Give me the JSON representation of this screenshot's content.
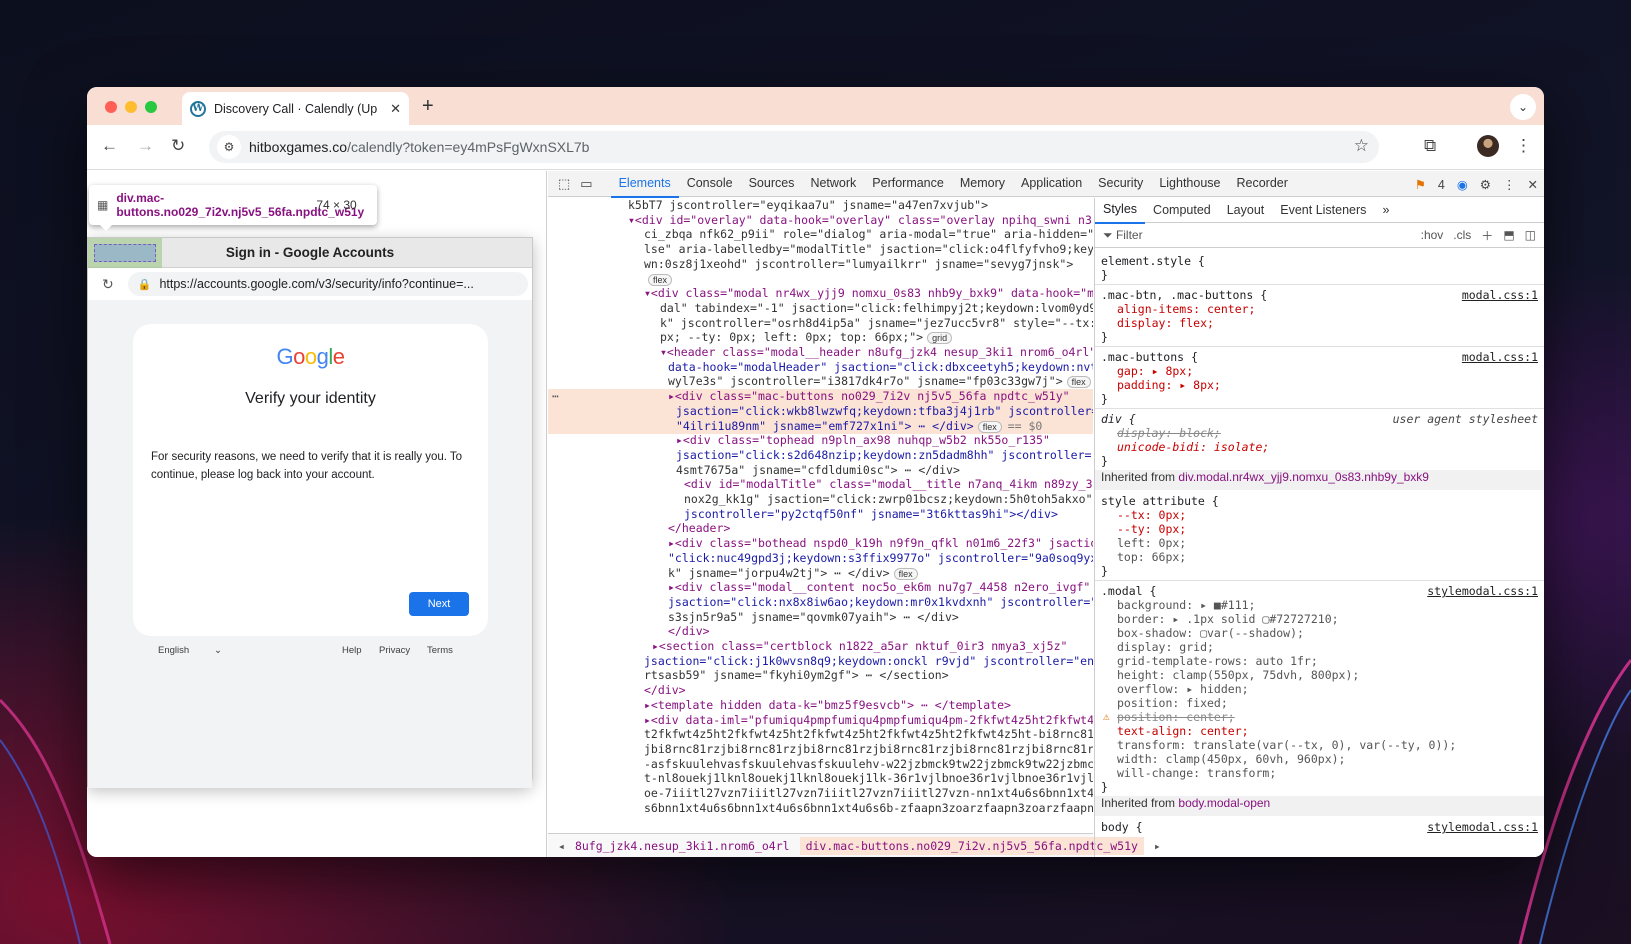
{
  "window": {
    "tab_title": "Discovery Call · Calendly (Up",
    "new_tab": "+"
  },
  "address": {
    "domain": "hitboxgames.co",
    "path": "/calendly?token=ey4mPsFgWxnSXL7b"
  },
  "inspect_tooltip": {
    "selector": "div.mac-buttons.no029_7i2v.nj5v5_56fa.npdtc_w51y",
    "size": "74 × 30"
  },
  "popup": {
    "title": "Sign in - Google Accounts",
    "url": "https://accounts.google.com/v3/security/info?continue=...",
    "logo": "Google",
    "heading": "Verify your identity",
    "message": "For security reasons, we need to verify that it is really you. To continue, please log back into your account.",
    "next": "Next",
    "language": "English",
    "help": "Help",
    "privacy": "Privacy",
    "terms": "Terms"
  },
  "devtools": {
    "tabs": [
      "Elements",
      "Console",
      "Sources",
      "Network",
      "Performance",
      "Memory",
      "Application",
      "Security",
      "Lighthouse",
      "Recorder"
    ],
    "issues_count": "4",
    "dom_lines": [
      "k5bT7  jscontroller=\"eyqikaa7u\"  jsname=\"a47en7xvjub\">",
      "▾<div id=\"overlay\" data-hook=\"overlay\" class=\"overlay npihq_swni n3j",
      "ci_zbqa nfk62_p9ii\" role=\"dialog\" aria-modal=\"true\" aria-hidden=\"fa",
      "lse\" aria-labelledby=\"modalTitle\" jsaction=\"click:o4flfyfvho9;keydo",
      "wn:0sz8j1xeohd\" jscontroller=\"lumyailkrr\" jsname=\"sevyg7jnsk\">",
      "flex",
      "▾<div class=\"modal nr4wx_yjj9 nomxu_0s83 nhb9y_bxk9\" data-hook=\"mo",
      "dal\" tabindex=\"-1\" jsaction=\"click:felhimpyj2t;keydown:lvom0yd9i",
      "k\" jscontroller=\"osrh8d4ip5a\" jsname=\"jez7ucc5vr8\" style=\"--tx: 0",
      "px; --ty: 0px; left: 0px; top: 66px;\">  grid",
      "▾<header class=\"modal__header n8ufg_jzk4 nesup_3ki1 nrom6_o4rl\"",
      "data-hook=\"modalHeader\" jsaction=\"click:dbxceetyh5;keydown:nvtd",
      "wyl7e3s\" jscontroller=\"i3817dk4r7o\" jsname=\"fp03c33gw7j\">  flex",
      "▸<div class=\"mac-buttons no029_7i2v nj5v5_56fa npdtc_w51y\"",
      "jsaction=\"click:wkb8lwzwfq;keydown:tfba3j4j1rb\" jscontroller=",
      "\"4ilri1u89nm\" jsname=\"emf727x1ni\"> ⋯ </div>  flex  == $0",
      "▸<div class=\"tophead n9pln_ax98 nuhqp_w5b2 nk55o_r135\"",
      "jsaction=\"click:s2d648nzip;keydown:zn5dadm8hh\" jscontroller=\"l",
      "4smt7675a\" jsname=\"cfdldumi0sc\"> ⋯ </div>",
      "<div id=\"modalTitle\" class=\"modal__title n7anq_4ikm n89zy_36zs",
      "nox2g_kk1g\" jsaction=\"click:zwrp01bcsz;keydown:5h0toh5akxo\"",
      "jscontroller=\"py2ctqf50nf\" jsname=\"3t6kttas9hi\"></div>",
      "</header>",
      "▸<div class=\"bothead nspd0_k19h n9f9n_qfkl n01m6_22f3\" jsaction=",
      "\"click:nuc49gpd3j;keydown:s3ffix9977o\" jscontroller=\"9a0soq9yx8",
      "k\" jsname=\"jorpu4w2tj\"> ⋯ </div>  flex",
      "▸<div class=\"modal__content noc5o_ek6m nu7g7_4458 n2ero_ivgf\"",
      "jsaction=\"click:nx8x8iw6ao;keydown:mr0x1kvdxnh\" jscontroller=\"2",
      "s3sjn5r9a5\" jsname=\"qovmk07yaih\"> ⋯ </div>",
      "</div>",
      "▸<section class=\"certblock n1822_a5ar nktuf_0ir3 nmya3_xj5z\"",
      "jsaction=\"click:j1k0wvsn8q9;keydown:onckl r9vjd\" jscontroller=\"enp",
      "rtsasb59\" jsname=\"fkyhi0ym2gf\"> ⋯ </section>",
      "</div>",
      "▸<template hidden data-k=\"bmz5f9esvcb\"> ⋯ </template>",
      "▸<div data-iml=\"pfumiqu4pmpfumiqu4pmpfumiqu4pm-2fkfwt4z5ht2fkfwt4z5h",
      "t2fkfwt4z5ht2fkfwt4z5ht2fkfwt4z5ht2fkfwt4z5ht2fkfwt4z5ht-bi8rnc81rz",
      "jbi8rnc81rzjbi8rnc81rzjbi8rnc81rzjbi8rnc81rzjbi8rnc81rzjbi8rnc81rz",
      "-asfskuulehvasfskuulehvasfskuulehv-w22jzbmck9tw22jzbmck9tw22jzbmck9",
      "t-nl8ouekj1lknl8ouekj1lknl8ouekj1lk-36r1vjlbnoe36r1vjlbnoe36r1vjlbn",
      "oe-7iiitl27vzn7iiitl27vzn7iiitl27vzn7iiitl27vzn-nn1xt4u6s6bnn1xt4u6",
      "s6bnn1xt4u6s6bnn1xt4u6s6bnn1xt4u6s6b-zfaapn3zoarzfaapn3zoarzfaapn3z"
    ],
    "breadcrumbs": [
      "8ufg_jzk4.nesup_3ki1.nrom6_o4rl",
      "div.mac-buttons.no029_7i2v.nj5v5_56fa.npdtc_w51y"
    ],
    "styles": {
      "tabs": [
        "Styles",
        "Computed",
        "Layout",
        "Event Listeners"
      ],
      "filter": "Filter",
      "hov": ":hov",
      "cls": ".cls",
      "element_style": "element.style {",
      "rule1_sel": ".mac-btn, .mac-buttons {",
      "rule1_src": "modal.css:1",
      "rule1_p1": "align-items: center;",
      "rule1_p2": "display: flex;",
      "rule2_sel": ".mac-buttons {",
      "rule2_src": "modal.css:1",
      "rule2_p1": "gap: ▸ 8px;",
      "rule2_p2": "padding: ▸ 8px;",
      "rule3_sel": "div {",
      "rule3_src": "user agent stylesheet",
      "rule3_p1": "display: block;",
      "rule3_p2": "unicode-bidi: isolate;",
      "inherited1_label": "Inherited from",
      "inherited1_sel": "div.modal.nr4wx_yjj9.nomxu_0s83.nhb9y_bxk9",
      "style_attr": "style attribute {",
      "sa1": "--tx: 0px;",
      "sa2": "--ty: 0px;",
      "sa3": "left: 0px;",
      "sa4": "top: 66px;",
      "rule4_sel": ".modal {",
      "rule4_src": "stylemodal.css:1",
      "m1": "background: ▸ ■#111;",
      "m2": "border: ▸ .1px solid ▢#72727210;",
      "m3": "box-shadow: ▢var(--shadow);",
      "m4": "display: grid;",
      "m5": "grid-template-rows: auto 1fr;",
      "m6": "height: clamp(550px, 75dvh, 800px);",
      "m7": "overflow: ▸ hidden;",
      "m8": "position: fixed;",
      "m9": "position: center;",
      "m10": "text-align: center;",
      "m11": "transform: translate(var(--tx, 0), var(--ty, 0));",
      "m12": "width: clamp(450px, 60vh, 960px);",
      "m13": "will-change: transform;",
      "inherited2_label": "Inherited from",
      "inherited2_sel": "body.modal-open",
      "body_sel": "body {",
      "body_src": "stylemodal.css:1"
    }
  },
  "colors": {
    "accent": "#1a73e8",
    "tag": "#881280",
    "attr": "#994500",
    "value": "#1a1aa6"
  }
}
